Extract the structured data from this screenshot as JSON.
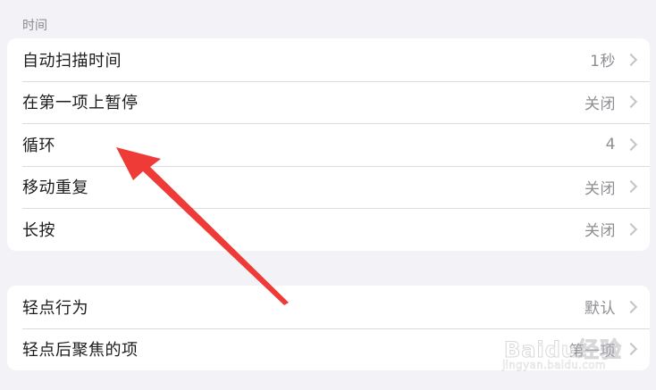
{
  "section_header": "时间",
  "timing_group": {
    "rows": [
      {
        "label": "自动扫描时间",
        "value": "1秒"
      },
      {
        "label": "在第一项上暂停",
        "value": "关闭"
      },
      {
        "label": "循环",
        "value": "4"
      },
      {
        "label": "移动重复",
        "value": "关闭"
      },
      {
        "label": "长按",
        "value": "关闭"
      }
    ]
  },
  "tap_group": {
    "rows": [
      {
        "label": "轻点行为",
        "value": "默认"
      },
      {
        "label": "轻点后聚焦的项",
        "value": "第一项"
      }
    ]
  },
  "annotation": {
    "color": "#ee3b37"
  },
  "watermark": {
    "logo": "Baidu经验",
    "url": "jingyan.baidu.com"
  },
  "colors": {
    "background": "#f2f2f7",
    "card": "#ffffff",
    "value_text": "#8e8e93"
  }
}
